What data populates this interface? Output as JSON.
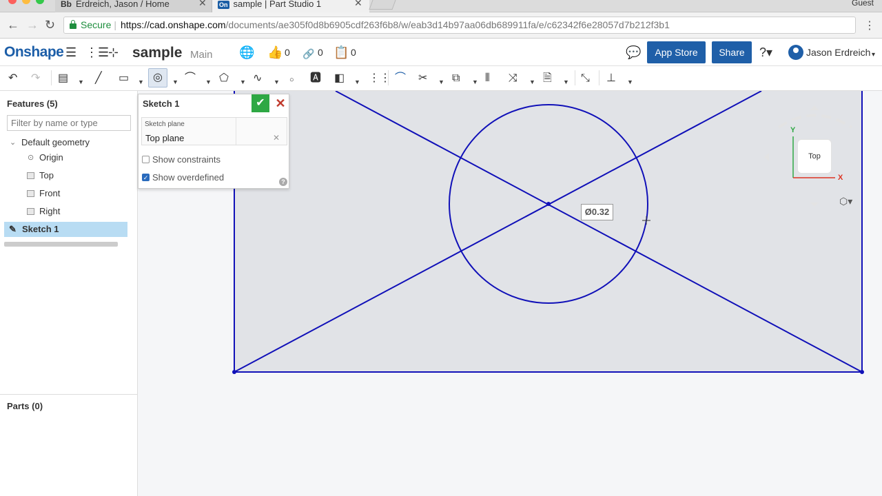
{
  "browser": {
    "tabs": [
      {
        "favicon": "Bb",
        "title": "Erdreich, Jason / Home"
      },
      {
        "favicon": "On",
        "title": "sample | Part Studio 1"
      }
    ],
    "guest_label": "Guest",
    "secure_label": "Secure",
    "url_host": "https://cad.onshape.com",
    "url_path": "/documents/ae305f0d8b6905cdf263f6b8/w/eab3d14b97aa06db689911fa/e/c62342f6e28057d7b212f3b1"
  },
  "header": {
    "logo": "Onshape",
    "doc_name": "sample",
    "workspace": "Main",
    "likes": "0",
    "links": "0",
    "copies": "0",
    "app_store": "App Store",
    "share": "Share",
    "user": "Jason Erdreich"
  },
  "features": {
    "title": "Features (5)",
    "filter_placeholder": "Filter by name or type",
    "items": [
      {
        "label": "Default geometry",
        "icon": "chevron-down-icon"
      },
      {
        "label": "Origin",
        "icon": "origin-icon"
      },
      {
        "label": "Top",
        "icon": "plane-icon"
      },
      {
        "label": "Front",
        "icon": "plane-icon"
      },
      {
        "label": "Right",
        "icon": "plane-icon"
      },
      {
        "label": "Sketch 1",
        "icon": "pencil-icon"
      }
    ]
  },
  "parts": {
    "title": "Parts (0)"
  },
  "sketch_dialog": {
    "title": "Sketch 1",
    "plane_label": "Sketch plane",
    "plane_value": "Top plane",
    "show_constraints": "Show constraints",
    "show_overdefined": "Show overdefined",
    "show_constraints_checked": false,
    "show_overdefined_checked": true
  },
  "canvas": {
    "dimension": "Ø0.32",
    "view_cube": "Top",
    "axis_y": "Y",
    "axis_x": "X",
    "sketch_color": "#1010b8"
  }
}
